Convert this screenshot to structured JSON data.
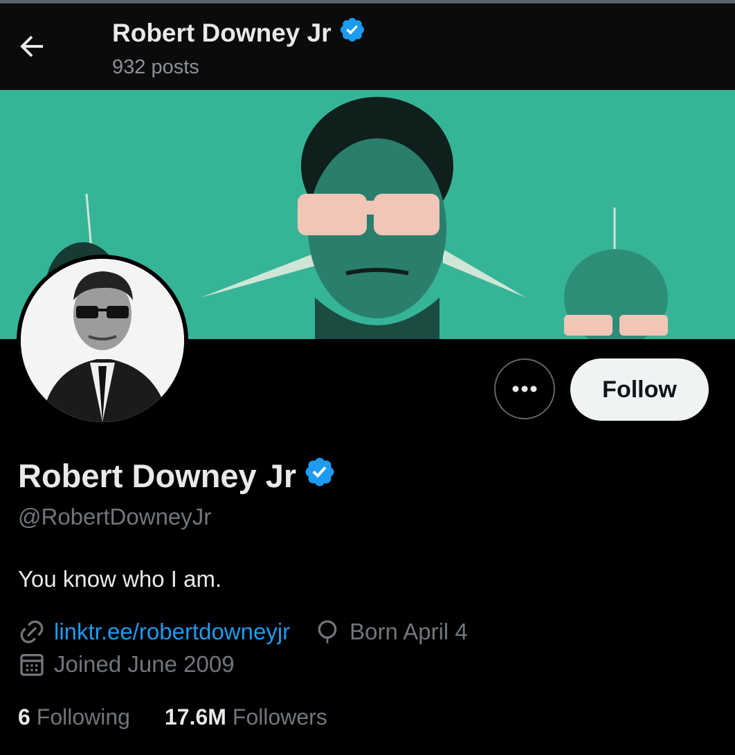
{
  "header": {
    "title": "Robert Downey Jr",
    "posts": "932 posts"
  },
  "profile": {
    "name": "Robert Downey Jr",
    "handle": "@RobertDowneyJr",
    "bio": "You know who I am.",
    "link": "linktr.ee/robertdowneyjr",
    "birthday": "Born April 4",
    "joined": "Joined June 2009"
  },
  "actions": {
    "follow_label": "Follow",
    "more_icon": "more-horizontal-icon"
  },
  "stats": {
    "following_count": "6",
    "following_label": "Following",
    "followers_count": "17.6M",
    "followers_label": "Followers"
  },
  "colors": {
    "background": "#000000",
    "accent": "#1d9bf0",
    "banner": "#36b497",
    "verified": "#1d9bf0"
  }
}
